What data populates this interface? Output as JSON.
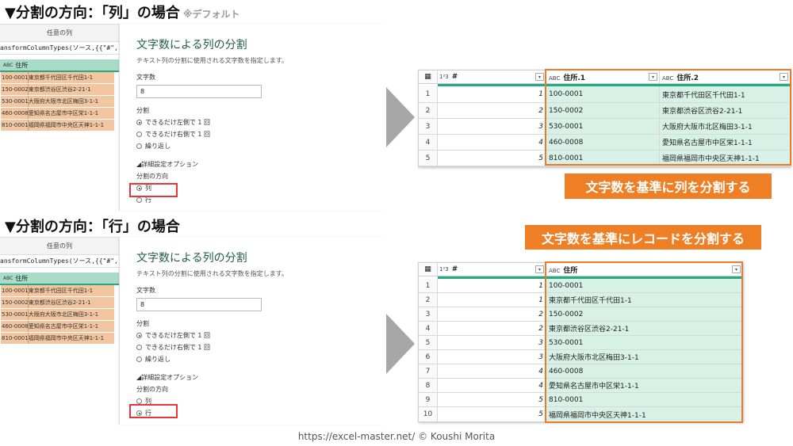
{
  "top": {
    "title": "▼分割の方向：「列」の場合",
    "note": "※デフォルト",
    "editor": {
      "column_name": "任意の列",
      "formula": "ansformColumnTypes(ソース,{{\"#\", I",
      "col_header": "住所",
      "type_icon": "ABC",
      "rows": [
        "100-0001東京都千代田区千代田1-1",
        "150-0002東京都渋谷区渋谷2-21-1",
        "530-0001大阪府大阪市北区梅田3-1-1",
        "460-0008愛知県名古屋市中区栄1-1-1",
        "810-0001福岡県福岡市中央区天神1-1-1"
      ]
    },
    "dialog": {
      "title": "文字数による列の分割",
      "description": "テキスト列の分割に使用される文字数を指定します。",
      "count_label": "文字数",
      "count_value": "8",
      "split_label": "分割",
      "split_options": [
        "できるだけ左側で 1 回",
        "できるだけ右側で 1 回",
        "繰り返し"
      ],
      "advanced_label": "◢詳細設定オプション",
      "direction_label": "分割の方向",
      "direction_options": [
        "列",
        "行"
      ],
      "selected_direction": "列"
    },
    "result": {
      "columns": [
        {
          "name": "#",
          "type_icon": "1²3"
        },
        {
          "name": "住所.1",
          "type_icon": "ABC"
        },
        {
          "name": "住所.2",
          "type_icon": "ABC"
        }
      ],
      "rows": [
        {
          "idx": "1",
          "num": "1",
          "a": "100-0001",
          "b": "東京都千代田区千代田1-1"
        },
        {
          "idx": "2",
          "num": "2",
          "a": "150-0002",
          "b": "東京都渋谷区渋谷2-21-1"
        },
        {
          "idx": "3",
          "num": "3",
          "a": "530-0001",
          "b": "大阪府大阪市北区梅田3-1-1"
        },
        {
          "idx": "4",
          "num": "4",
          "a": "460-0008",
          "b": "愛知県名古屋市中区栄1-1-1"
        },
        {
          "idx": "5",
          "num": "5",
          "a": "810-0001",
          "b": "福岡県福岡市中央区天神1-1-1"
        }
      ]
    },
    "banner": "文字数を基準に列を分割する"
  },
  "bottom": {
    "title": "▼分割の方向：「行」の場合",
    "editor": {
      "column_name": "任意の列",
      "formula": "ansformColumnTypes(ソース,{{\"#\", I",
      "col_header": "住所",
      "type_icon": "ABC",
      "rows": [
        "100-0001東京都千代田区千代田1-1",
        "150-0002東京都渋谷区渋谷2-21-1",
        "530-0001大阪府大阪市北区梅田3-1-1",
        "460-0008愛知県名古屋市中区栄1-1-1",
        "810-0001福岡県福岡市中央区天神1-1-1"
      ]
    },
    "dialog": {
      "title": "文字数による列の分割",
      "description": "テキスト列の分割に使用される文字数を指定します。",
      "count_label": "文字数",
      "count_value": "8",
      "split_label": "分割",
      "split_options": [
        "できるだけ左側で 1 回",
        "できるだけ右側で 1 回",
        "繰り返し"
      ],
      "advanced_label": "◢詳細設定オプション",
      "direction_label": "分割の方向",
      "direction_options": [
        "列",
        "行"
      ],
      "selected_direction": "行"
    },
    "result": {
      "columns": [
        {
          "name": "#",
          "type_icon": "1²3"
        },
        {
          "name": "住所",
          "type_icon": "ABC"
        }
      ],
      "rows": [
        {
          "idx": "1",
          "num": "1",
          "a": "100-0001"
        },
        {
          "idx": "2",
          "num": "1",
          "a": "東京都千代田区千代田1-1"
        },
        {
          "idx": "3",
          "num": "2",
          "a": "150-0002"
        },
        {
          "idx": "4",
          "num": "2",
          "a": "東京都渋谷区渋谷2-21-1"
        },
        {
          "idx": "5",
          "num": "3",
          "a": "530-0001"
        },
        {
          "idx": "6",
          "num": "3",
          "a": "大阪府大阪市北区梅田3-1-1"
        },
        {
          "idx": "7",
          "num": "4",
          "a": "460-0008"
        },
        {
          "idx": "8",
          "num": "4",
          "a": "愛知県名古屋市中区栄1-1-1"
        },
        {
          "idx": "9",
          "num": "5",
          "a": "810-0001"
        },
        {
          "idx": "10",
          "num": "5",
          "a": "福岡県福岡市中央区天神1-1-1"
        }
      ]
    },
    "banner": "文字数を基準にレコードを分割する"
  },
  "footer": "https://excel-master.net/  © Koushi Morita",
  "colors": {
    "teal": "#25a884",
    "orange": "#ee7f25",
    "highlight_red": "#e8343a",
    "cell_green": "#d8f1e6",
    "cell_orange": "#f2c6a0"
  }
}
